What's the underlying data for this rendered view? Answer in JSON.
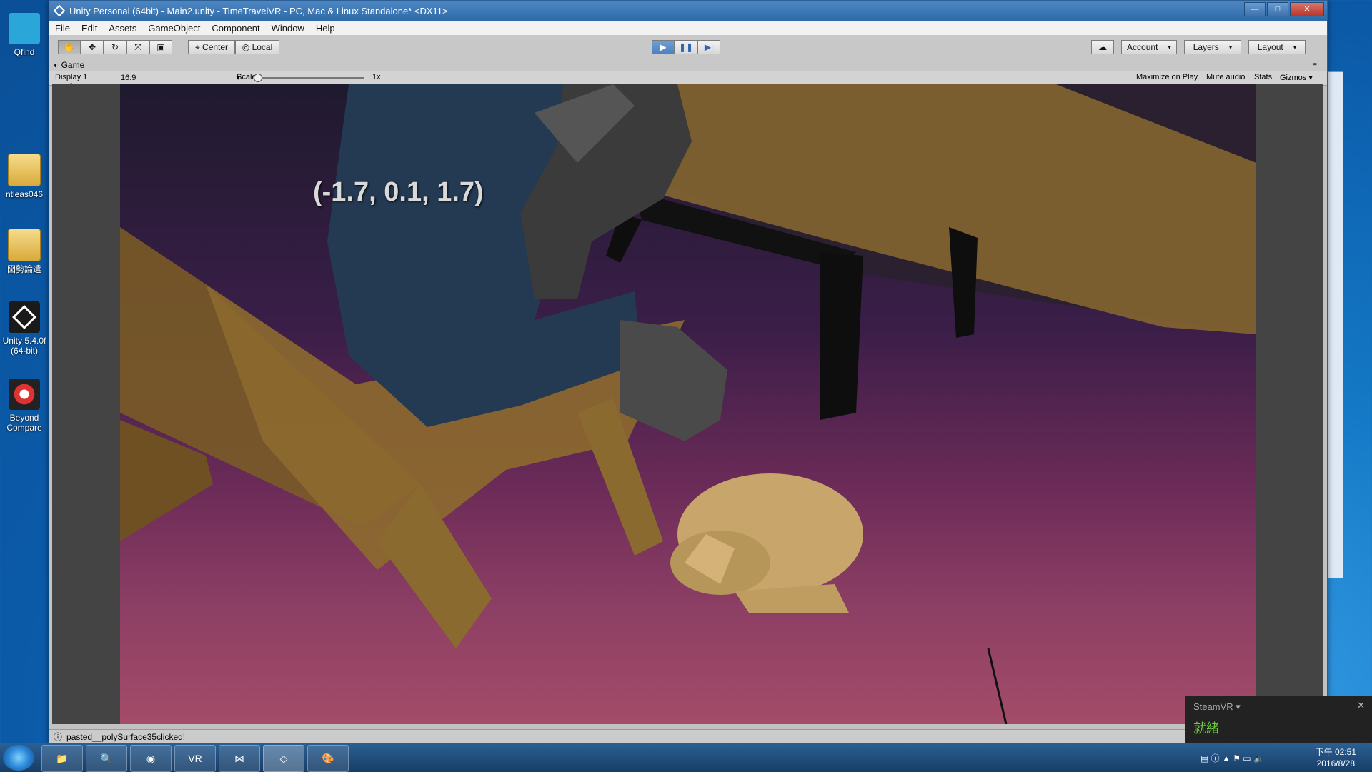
{
  "desktop": {
    "icons": [
      {
        "label": "Qfind",
        "icon": "qfind-icon"
      },
      {
        "label": "ntleas046",
        "icon": "folder-icon"
      },
      {
        "label": "図勢論遣",
        "icon": "folder-icon"
      },
      {
        "label": "Unity 5.4.0f (64-bit)",
        "icon": "unity-icon"
      },
      {
        "label": "Beyond Compare",
        "icon": "beyond-compare-icon"
      }
    ]
  },
  "window": {
    "title": "Unity Personal (64bit) - Main2.unity - TimeTravelVR - PC, Mac & Linux Standalone* <DX11>",
    "buttons": {
      "minimize": "—",
      "maximize": "□",
      "close": "✕"
    }
  },
  "menu": [
    "File",
    "Edit",
    "Assets",
    "GameObject",
    "Component",
    "Window",
    "Help"
  ],
  "toolbar": {
    "tools": [
      "hand-tool-icon",
      "move-tool-icon",
      "rotate-tool-icon",
      "scale-tool-icon",
      "rect-tool-icon"
    ],
    "pivot_label": "Center",
    "space_label": "Local",
    "play": {
      "play_icon": "▶",
      "pause_icon": "❚❚",
      "step_icon": "▶|"
    },
    "cloud_icon": "cloud-icon",
    "account_label": "Account",
    "layers_label": "Layers",
    "layout_label": "Layout"
  },
  "game_view": {
    "tab_label": "Game",
    "display_label": "Display 1",
    "aspect_label": "16:9",
    "scale_label": "Scale",
    "scale_value": "1x",
    "scale_fraction": 0.0,
    "maximize_on_play": "Maximize on Play",
    "mute_audio": "Mute audio",
    "stats": "Stats",
    "gizmos": "Gizmos",
    "overlay_text": "(-1.7, 0.1, 1.7)"
  },
  "status_bar": {
    "message": "pasted__polySurface35clicked!"
  },
  "steamvr": {
    "title": "SteamVR ▾",
    "status": "就緒"
  },
  "taskbar": {
    "apps": [
      "explorer",
      "qfind",
      "chrome",
      "vr",
      "visual-studio",
      "unity",
      "paint"
    ],
    "clock_time": "下午 02:51",
    "clock_date": "2016/8/28"
  }
}
